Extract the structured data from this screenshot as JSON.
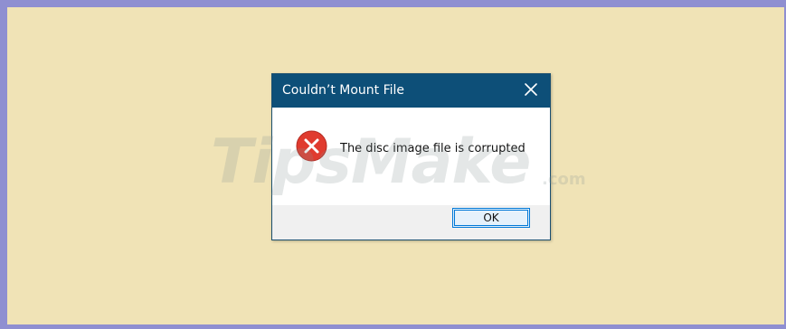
{
  "dialog": {
    "title": "Couldn’t Mount File",
    "message": "The disc image file is corrupted",
    "ok_label": "OK"
  },
  "icons": {
    "close": "close-icon",
    "error": "error-icon"
  },
  "watermark": {
    "main": "TipsMake",
    "suffix": ".com"
  },
  "colors": {
    "background": "#f0e3b6",
    "frame_border": "#8f8fd1",
    "titlebar": "#0d4f78",
    "error_red": "#e03b2f",
    "button_border": "#0078d7"
  }
}
